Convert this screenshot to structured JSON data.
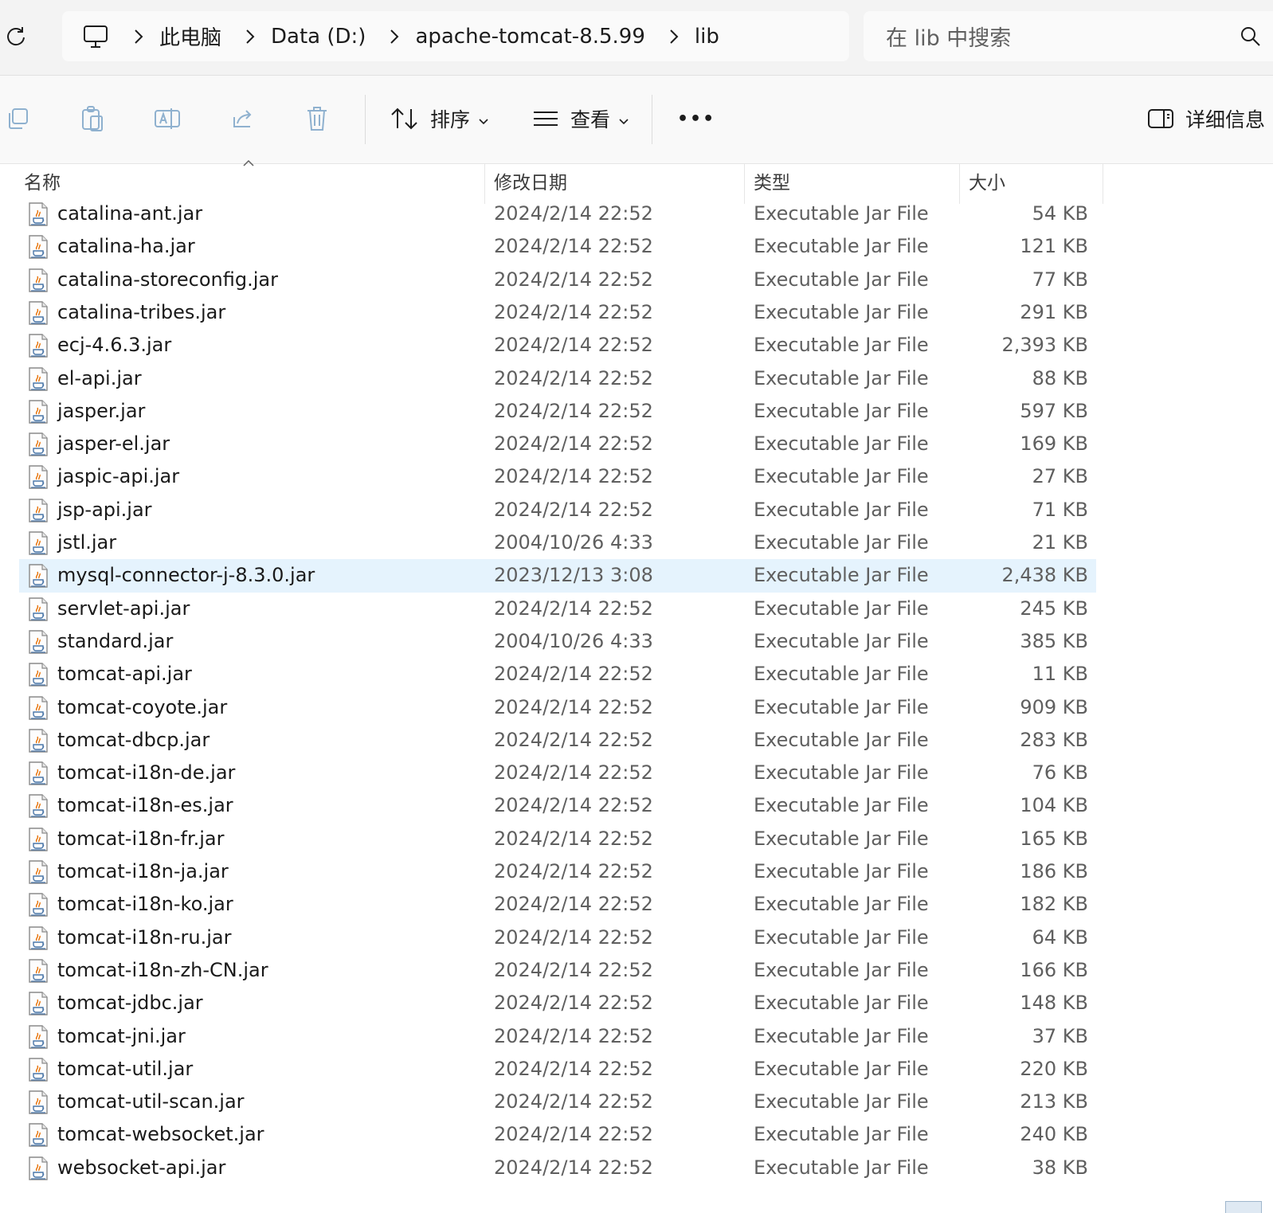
{
  "address_bar": {
    "breadcrumbs": [
      "此电脑",
      "Data (D:)",
      "apache-tomcat-8.5.99",
      "lib"
    ],
    "search_placeholder": "在 lib 中搜索"
  },
  "toolbar": {
    "sort_label": "排序",
    "view_label": "查看",
    "more_label": "•••",
    "details_label": "详细信息"
  },
  "columns": {
    "name": "名称",
    "date": "修改日期",
    "type": "类型",
    "size": "大小"
  },
  "colors": {
    "selected_row": "#e5f3fd",
    "accent": "#0067c0"
  },
  "files": [
    {
      "name": "catalina-ant.jar",
      "date": "2024/2/14 22:52",
      "type": "Executable Jar File",
      "size": "54 KB"
    },
    {
      "name": "catalina-ha.jar",
      "date": "2024/2/14 22:52",
      "type": "Executable Jar File",
      "size": "121 KB"
    },
    {
      "name": "catalina-storeconfig.jar",
      "date": "2024/2/14 22:52",
      "type": "Executable Jar File",
      "size": "77 KB"
    },
    {
      "name": "catalina-tribes.jar",
      "date": "2024/2/14 22:52",
      "type": "Executable Jar File",
      "size": "291 KB"
    },
    {
      "name": "ecj-4.6.3.jar",
      "date": "2024/2/14 22:52",
      "type": "Executable Jar File",
      "size": "2,393 KB"
    },
    {
      "name": "el-api.jar",
      "date": "2024/2/14 22:52",
      "type": "Executable Jar File",
      "size": "88 KB"
    },
    {
      "name": "jasper.jar",
      "date": "2024/2/14 22:52",
      "type": "Executable Jar File",
      "size": "597 KB"
    },
    {
      "name": "jasper-el.jar",
      "date": "2024/2/14 22:52",
      "type": "Executable Jar File",
      "size": "169 KB"
    },
    {
      "name": "jaspic-api.jar",
      "date": "2024/2/14 22:52",
      "type": "Executable Jar File",
      "size": "27 KB"
    },
    {
      "name": "jsp-api.jar",
      "date": "2024/2/14 22:52",
      "type": "Executable Jar File",
      "size": "71 KB"
    },
    {
      "name": "jstl.jar",
      "date": "2004/10/26 4:33",
      "type": "Executable Jar File",
      "size": "21 KB"
    },
    {
      "name": "mysql-connector-j-8.3.0.jar",
      "date": "2023/12/13 3:08",
      "type": "Executable Jar File",
      "size": "2,438 KB",
      "selected": true
    },
    {
      "name": "servlet-api.jar",
      "date": "2024/2/14 22:52",
      "type": "Executable Jar File",
      "size": "245 KB"
    },
    {
      "name": "standard.jar",
      "date": "2004/10/26 4:33",
      "type": "Executable Jar File",
      "size": "385 KB"
    },
    {
      "name": "tomcat-api.jar",
      "date": "2024/2/14 22:52",
      "type": "Executable Jar File",
      "size": "11 KB"
    },
    {
      "name": "tomcat-coyote.jar",
      "date": "2024/2/14 22:52",
      "type": "Executable Jar File",
      "size": "909 KB"
    },
    {
      "name": "tomcat-dbcp.jar",
      "date": "2024/2/14 22:52",
      "type": "Executable Jar File",
      "size": "283 KB"
    },
    {
      "name": "tomcat-i18n-de.jar",
      "date": "2024/2/14 22:52",
      "type": "Executable Jar File",
      "size": "76 KB"
    },
    {
      "name": "tomcat-i18n-es.jar",
      "date": "2024/2/14 22:52",
      "type": "Executable Jar File",
      "size": "104 KB"
    },
    {
      "name": "tomcat-i18n-fr.jar",
      "date": "2024/2/14 22:52",
      "type": "Executable Jar File",
      "size": "165 KB"
    },
    {
      "name": "tomcat-i18n-ja.jar",
      "date": "2024/2/14 22:52",
      "type": "Executable Jar File",
      "size": "186 KB"
    },
    {
      "name": "tomcat-i18n-ko.jar",
      "date": "2024/2/14 22:52",
      "type": "Executable Jar File",
      "size": "182 KB"
    },
    {
      "name": "tomcat-i18n-ru.jar",
      "date": "2024/2/14 22:52",
      "type": "Executable Jar File",
      "size": "64 KB"
    },
    {
      "name": "tomcat-i18n-zh-CN.jar",
      "date": "2024/2/14 22:52",
      "type": "Executable Jar File",
      "size": "166 KB"
    },
    {
      "name": "tomcat-jdbc.jar",
      "date": "2024/2/14 22:52",
      "type": "Executable Jar File",
      "size": "148 KB"
    },
    {
      "name": "tomcat-jni.jar",
      "date": "2024/2/14 22:52",
      "type": "Executable Jar File",
      "size": "37 KB"
    },
    {
      "name": "tomcat-util.jar",
      "date": "2024/2/14 22:52",
      "type": "Executable Jar File",
      "size": "220 KB"
    },
    {
      "name": "tomcat-util-scan.jar",
      "date": "2024/2/14 22:52",
      "type": "Executable Jar File",
      "size": "213 KB"
    },
    {
      "name": "tomcat-websocket.jar",
      "date": "2024/2/14 22:52",
      "type": "Executable Jar File",
      "size": "240 KB"
    },
    {
      "name": "websocket-api.jar",
      "date": "2024/2/14 22:52",
      "type": "Executable Jar File",
      "size": "38 KB"
    }
  ]
}
